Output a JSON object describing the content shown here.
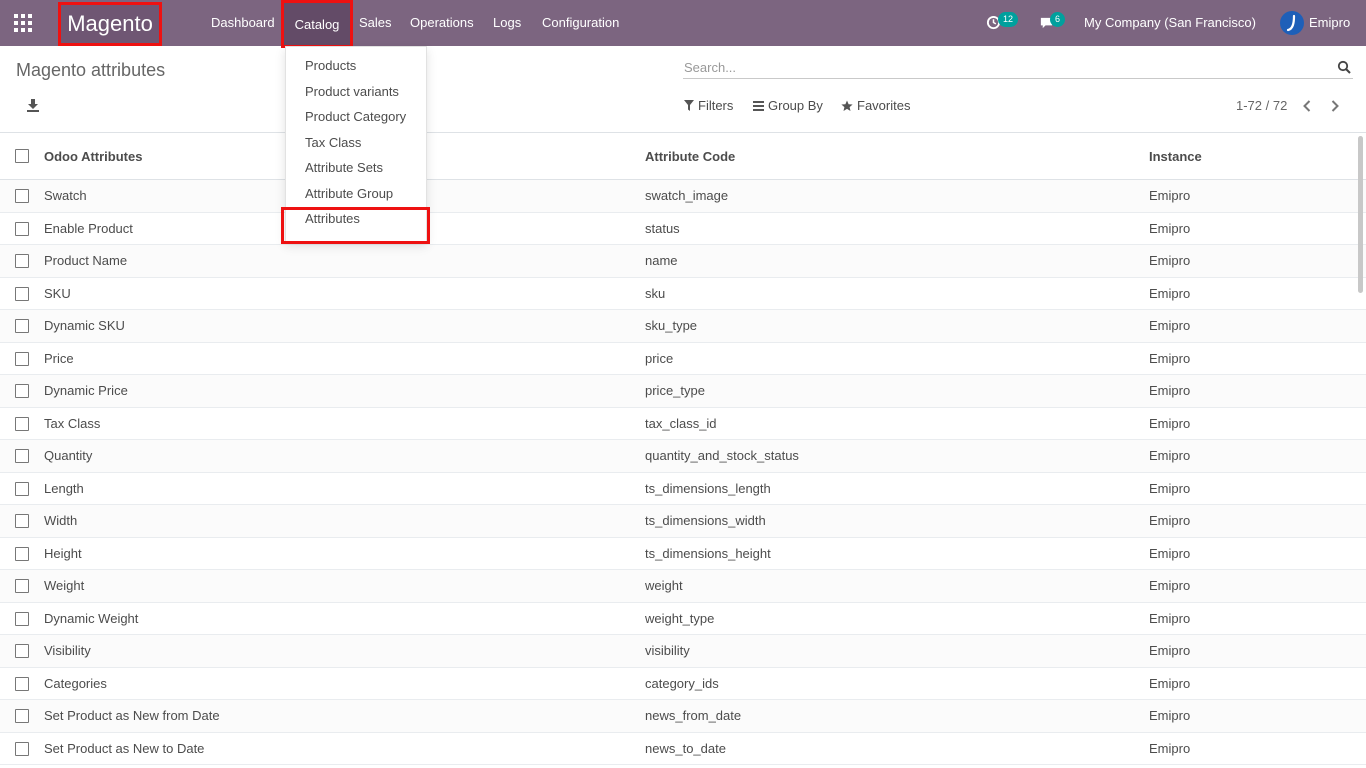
{
  "navbar": {
    "brand": "Magento",
    "menu": [
      "Dashboard",
      "Catalog",
      "Sales",
      "Operations",
      "Logs",
      "Configuration"
    ],
    "activities_count": "12",
    "messages_count": "6",
    "company": "My Company (San Francisco)",
    "user": "Emipro",
    "colors": {
      "bar": "#7c6580",
      "badge": "#00a09d",
      "highlight": "#ee1111"
    }
  },
  "catalog_menu": {
    "items": [
      "Products",
      "Product variants",
      "Product Category",
      "Tax Class",
      "Attribute Sets",
      "Attribute Group",
      "Attributes"
    ]
  },
  "control": {
    "title": "Magento attributes",
    "search_placeholder": "Search...",
    "filters": "Filters",
    "group_by": "Group By",
    "favorites": "Favorites",
    "pager": "1-72 / 72"
  },
  "table": {
    "headers": [
      "Odoo Attributes",
      "Attribute Code",
      "Instance"
    ],
    "rows": [
      [
        "Swatch",
        "swatch_image",
        "Emipro"
      ],
      [
        "Enable Product",
        "status",
        "Emipro"
      ],
      [
        "Product Name",
        "name",
        "Emipro"
      ],
      [
        "SKU",
        "sku",
        "Emipro"
      ],
      [
        "Dynamic SKU",
        "sku_type",
        "Emipro"
      ],
      [
        "Price",
        "price",
        "Emipro"
      ],
      [
        "Dynamic Price",
        "price_type",
        "Emipro"
      ],
      [
        "Tax Class",
        "tax_class_id",
        "Emipro"
      ],
      [
        "Quantity",
        "quantity_and_stock_status",
        "Emipro"
      ],
      [
        "Length",
        "ts_dimensions_length",
        "Emipro"
      ],
      [
        "Width",
        "ts_dimensions_width",
        "Emipro"
      ],
      [
        "Height",
        "ts_dimensions_height",
        "Emipro"
      ],
      [
        "Weight",
        "weight",
        "Emipro"
      ],
      [
        "Dynamic Weight",
        "weight_type",
        "Emipro"
      ],
      [
        "Visibility",
        "visibility",
        "Emipro"
      ],
      [
        "Categories",
        "category_ids",
        "Emipro"
      ],
      [
        "Set Product as New from Date",
        "news_from_date",
        "Emipro"
      ],
      [
        "Set Product as New to Date",
        "news_to_date",
        "Emipro"
      ]
    ]
  }
}
